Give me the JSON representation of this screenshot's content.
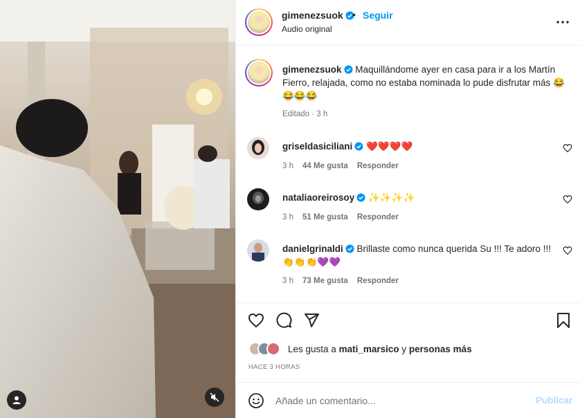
{
  "post": {
    "username": "gimenezsuok",
    "dot": "•",
    "follow_label": "Seguir",
    "audio_label": "Audio original",
    "caption": "Maquillándome ayer en casa para ir a los Martín Fierro, relajada, como no estaba nominada lo pude disfrutar más 😂😂😂😂",
    "caption_meta": "Editado · 3 h"
  },
  "comments": [
    {
      "username": "griseldasiciliani",
      "text": "❤️❤️❤️❤️",
      "time": "3 h",
      "likes": "44 Me gusta",
      "reply_label": "Responder"
    },
    {
      "username": "nataliaoreirosoy",
      "text": "✨✨✨✨",
      "time": "3 h",
      "likes": "51 Me gusta",
      "reply_label": "Responder"
    },
    {
      "username": "danielgrinaldi",
      "text": "Brillaste como nunca querida Su !!! Te adoro !!! 👏👏👏💜💜",
      "time": "3 h",
      "likes": "73 Me gusta",
      "reply_label": "Responder"
    }
  ],
  "likes_line": {
    "prefix": "Les gusta a",
    "user": "mati_marsico",
    "connector": "y",
    "others": "personas más"
  },
  "time_ago": "HACE 3 HORAS",
  "composer": {
    "placeholder": "Añade un comentario...",
    "post_label": "Publicar"
  },
  "icons": {
    "header": [
      "verified-icon",
      "more-options-icon"
    ],
    "actions": [
      "heart-icon",
      "comment-icon",
      "share-icon",
      "bookmark-icon"
    ],
    "media": [
      "user-tag-icon",
      "muted-audio-icon"
    ],
    "composer": [
      "emoji-icon"
    ]
  },
  "colors": {
    "accent": "#0095f6",
    "verified": "#0095f6",
    "muted_text": "#737373",
    "publish_disabled": "#b3dbff"
  }
}
